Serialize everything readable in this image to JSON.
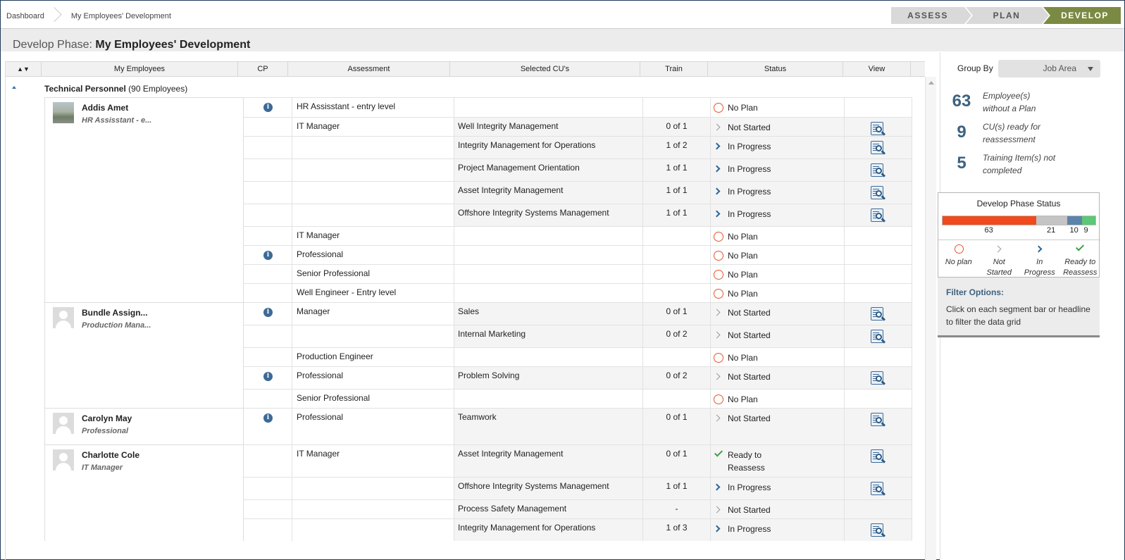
{
  "breadcrumb": [
    "Dashboard",
    "My Employees' Development"
  ],
  "phases": {
    "assess": "ASSESS",
    "plan": "PLAN",
    "develop": "DEVELOP",
    "active": "DEVELOP",
    "active_color": "#7b8a43"
  },
  "title": {
    "prefix": "Develop Phase:",
    "name": "My Employees' Development"
  },
  "columns": {
    "sort": "▲▼",
    "employees": "My Employees",
    "cp": "CP",
    "assessment": "Assessment",
    "cus": "Selected CU's",
    "train": "Train",
    "status": "Status",
    "view": "View"
  },
  "group": {
    "name": "Technical Personnel",
    "count": "(90 Employees)"
  },
  "employees": [
    {
      "name": "Addis Amet",
      "role": "HR Assisstant - e...",
      "photo": true,
      "rows": [
        {
          "cp": true,
          "assessment": "HR Assisstant - entry level",
          "cu": "",
          "train": "",
          "status": "No Plan",
          "status_type": "noplan",
          "view": false
        },
        {
          "cp": false,
          "assessment": "IT Manager",
          "cu": "Well Integrity Management",
          "train": "0 of 1",
          "status": "Not Started",
          "status_type": "notstarted",
          "view": true
        },
        {
          "cp": false,
          "assessment": "",
          "cu": "Integrity Management for Operations",
          "train": "1 of 2",
          "status": "In Progress",
          "status_type": "inprogress",
          "view": true
        },
        {
          "cp": false,
          "assessment": "",
          "cu": "Project Management Orientation",
          "train": "1 of 1",
          "status": "In Progress",
          "status_type": "inprogress",
          "view": true
        },
        {
          "cp": false,
          "assessment": "",
          "cu": "Asset Integrity Management",
          "train": "1 of 1",
          "status": "In Progress",
          "status_type": "inprogress",
          "view": true
        },
        {
          "cp": false,
          "assessment": "",
          "cu": "Offshore Integrity Systems Management",
          "train": "1 of 1",
          "status": "In Progress",
          "status_type": "inprogress",
          "view": true
        },
        {
          "cp": false,
          "assessment": "IT Manager",
          "cu": "",
          "train": "",
          "status": "No Plan",
          "status_type": "noplan",
          "view": false
        },
        {
          "cp": true,
          "assessment": "Professional",
          "cu": "",
          "train": "",
          "status": "No Plan",
          "status_type": "noplan",
          "view": false
        },
        {
          "cp": false,
          "assessment": "Senior Professional",
          "cu": "",
          "train": "",
          "status": "No Plan",
          "status_type": "noplan",
          "view": false
        },
        {
          "cp": false,
          "assessment": "Well Engineer - Entry level",
          "cu": "",
          "train": "",
          "status": "No Plan",
          "status_type": "noplan",
          "view": false
        }
      ]
    },
    {
      "name": "Bundle Assign...",
      "role": "Production Mana...",
      "photo": false,
      "rows": [
        {
          "cp": true,
          "assessment": "Manager",
          "cu": "Sales",
          "train": "0 of 1",
          "status": "Not Started",
          "status_type": "notstarted",
          "view": true
        },
        {
          "cp": false,
          "assessment": "",
          "cu": "Internal Marketing",
          "train": "0 of 2",
          "status": "Not Started",
          "status_type": "notstarted",
          "view": true
        },
        {
          "cp": false,
          "assessment": "Production Engineer",
          "cu": "",
          "train": "",
          "status": "No Plan",
          "status_type": "noplan",
          "view": false
        },
        {
          "cp": true,
          "assessment": "Professional",
          "cu": "Problem Solving",
          "train": "0 of 2",
          "status": "Not Started",
          "status_type": "notstarted",
          "view": true
        },
        {
          "cp": false,
          "assessment": "Senior Professional",
          "cu": "",
          "train": "",
          "status": "No Plan",
          "status_type": "noplan",
          "view": false
        }
      ]
    },
    {
      "name": "Carolyn May",
      "role": "Professional",
      "photo": false,
      "rows": [
        {
          "cp": true,
          "assessment": "Professional",
          "cu": "Teamwork",
          "train": "0 of 1",
          "status": "Not Started",
          "status_type": "notstarted",
          "view": true
        }
      ]
    },
    {
      "name": "Charlotte Cole",
      "role": "IT Manager",
      "photo": false,
      "rows": [
        {
          "cp": false,
          "assessment": "IT Manager",
          "cu": "Asset Integrity Management",
          "train": "0 of 1",
          "status": "Ready to Reassess",
          "status_type": "ready",
          "view": true
        },
        {
          "cp": false,
          "assessment": "",
          "cu": "Offshore Integrity Systems Management",
          "train": "1 of 1",
          "status": "In Progress",
          "status_type": "inprogress",
          "view": true
        },
        {
          "cp": false,
          "assessment": "",
          "cu": "Process Safety Management",
          "train": "-",
          "status": "Not Started",
          "status_type": "notstarted",
          "view": false
        },
        {
          "cp": false,
          "assessment": "",
          "cu": "Integrity Management for Operations",
          "train": "1 of 3",
          "status": "In Progress",
          "status_type": "inprogress",
          "view": true
        }
      ]
    }
  ],
  "groupby": {
    "label": "Group By",
    "value": "Job Area"
  },
  "kpis": [
    {
      "num": "63",
      "line1": "Employee(s)",
      "line2": "without a Plan"
    },
    {
      "num": "9",
      "line1": "CU(s) ready for",
      "line2": "reassessment"
    },
    {
      "num": "5",
      "line1": "Training Item(s) not",
      "line2": "completed"
    }
  ],
  "develop_status": {
    "title": "Develop Phase Status",
    "segments": [
      {
        "key": "noplan",
        "value": 63,
        "label": "63",
        "color": "#f04a1d"
      },
      {
        "key": "notstarted",
        "value": 21,
        "label": "21",
        "color": "#c4c4c4"
      },
      {
        "key": "inprogress",
        "value": 10,
        "label": "10",
        "color": "#5c84ab"
      },
      {
        "key": "ready",
        "value": 9,
        "label": "9",
        "color": "#5cc776"
      }
    ],
    "legend": [
      {
        "key": "noplan",
        "l1": "No plan",
        "l2": ""
      },
      {
        "key": "notstarted",
        "l1": "Not",
        "l2": "Started"
      },
      {
        "key": "inprogress",
        "l1": "In",
        "l2": "Progress"
      },
      {
        "key": "ready",
        "l1": "Ready to",
        "l2": "Reassess"
      }
    ]
  },
  "filter": {
    "title": "Filter Options:",
    "body": "Click on each segment bar or headline to filter the data grid"
  }
}
